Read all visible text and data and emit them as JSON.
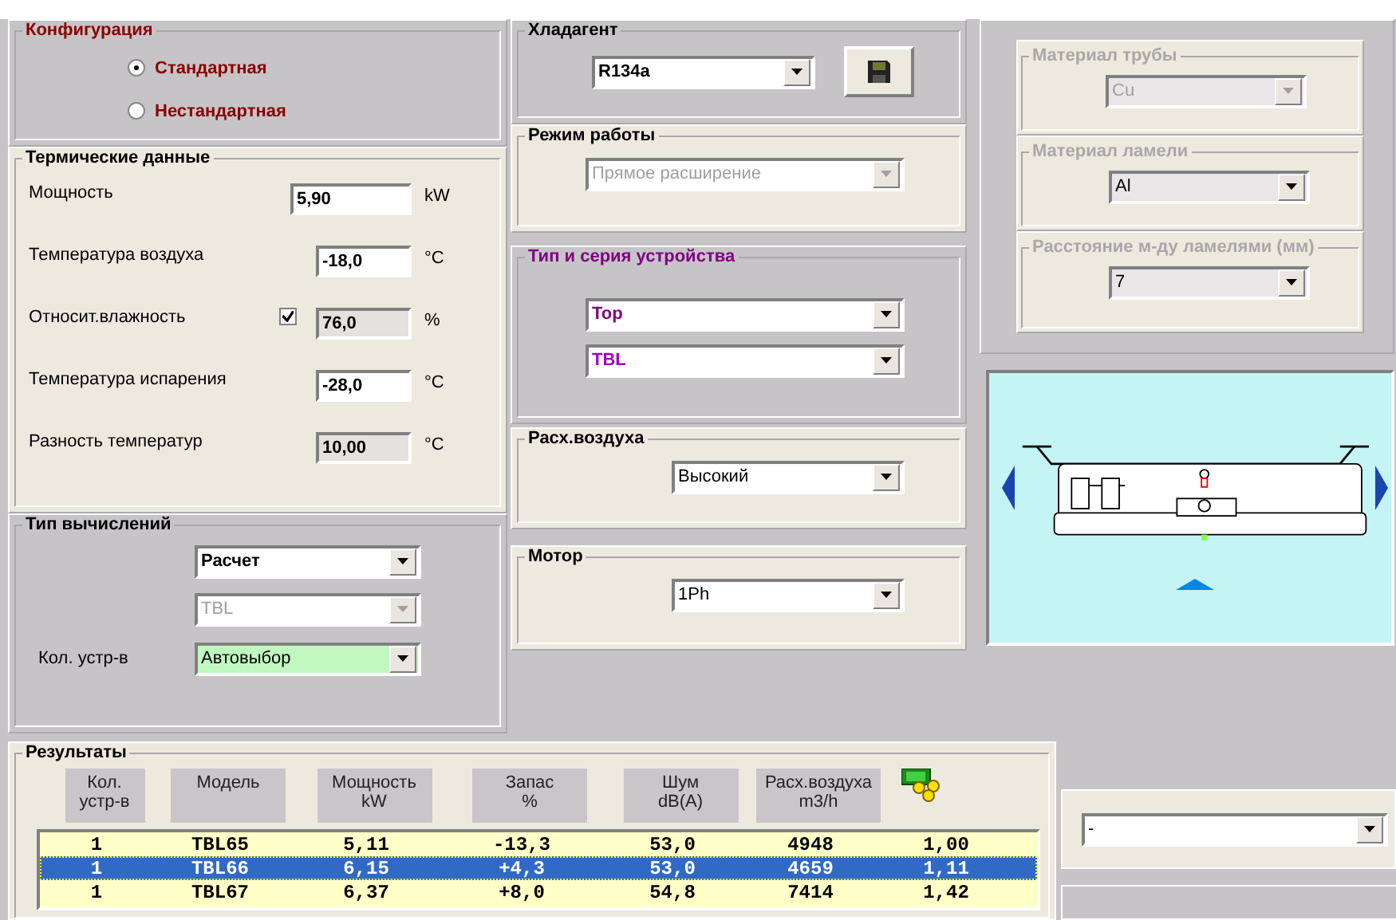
{
  "configuration": {
    "title": "Конфигурация",
    "options": [
      {
        "label": "Стандартная",
        "selected": true
      },
      {
        "label": "Нестандартная",
        "selected": false
      }
    ]
  },
  "thermal": {
    "title": "Термические данные",
    "fields": [
      {
        "kind": "wide",
        "label": "Мощность",
        "value": "5,90",
        "unit": "kW",
        "readonly": false
      },
      {
        "kind": "plain",
        "label": "Температура воздуха",
        "value": "-18,0",
        "unit": "°C",
        "readonly": false
      },
      {
        "kind": "check",
        "label": "Относит.влажность",
        "value": "76,0",
        "unit": "%",
        "readonly": true,
        "checked": true
      },
      {
        "kind": "plain",
        "label": "Температура испарения",
        "value": "-28,0",
        "unit": "°C",
        "readonly": false
      },
      {
        "kind": "plain",
        "label": "Разность температур",
        "value": "10,00",
        "unit": "°C",
        "readonly": true
      }
    ]
  },
  "calculation": {
    "title": "Тип вычислений",
    "mode": {
      "value": "Расчет",
      "disabled": false
    },
    "series": {
      "value": "TBL",
      "disabled": true
    },
    "count": {
      "label": "Кол. устр-в",
      "value": "Автовыбор",
      "disabled": false
    }
  },
  "refrigerant": {
    "title": "Хладагент",
    "value": "R134a",
    "disabled": false
  },
  "operation": {
    "title": "Режим работы",
    "value": "Прямое расширение",
    "disabled": true
  },
  "device": {
    "title": "Тип и серия устройства",
    "type": {
      "value": "Top",
      "disabled": false
    },
    "series": {
      "value": "TBL",
      "disabled": false
    }
  },
  "airflow": {
    "title": "Расх.воздуха",
    "value": "Высокий",
    "disabled": false
  },
  "motor": {
    "title": "Мотор",
    "value": "1Ph",
    "disabled": false
  },
  "materials": [
    {
      "title": "Материал трубы",
      "value": "Cu",
      "disabled": true
    },
    {
      "title": "Материал ламели",
      "value": "Al",
      "disabled": false
    },
    {
      "title": "Расстояние м-ду ламелями (мм)",
      "value": "7",
      "disabled": false
    }
  ],
  "results": {
    "title": "Результаты",
    "columns": [
      {
        "kind": "text",
        "lines": [
          "Кол.",
          "устр-в"
        ]
      },
      {
        "kind": "text",
        "lines": [
          "Модель"
        ]
      },
      {
        "kind": "text",
        "lines": [
          "Мощность",
          "kW"
        ]
      },
      {
        "kind": "text",
        "lines": [
          "Запас",
          "%"
        ]
      },
      {
        "kind": "text",
        "lines": [
          "Шум",
          "dB(A)"
        ]
      },
      {
        "kind": "text",
        "lines": [
          "Расх.воздуха",
          "m3/h"
        ]
      },
      {
        "kind": "price"
      }
    ],
    "rows": [
      {
        "selected": false,
        "cells": [
          "1",
          "TBL65",
          "5,11",
          "-13,3",
          "53,0",
          "4948",
          "1,00"
        ]
      },
      {
        "selected": true,
        "cells": [
          "1",
          "TBL66",
          "6,15",
          "+4,3",
          "53,0",
          "4659",
          "1,11"
        ]
      },
      {
        "selected": false,
        "cells": [
          "1",
          "TBL67",
          "6,37",
          "+8,0",
          "54,8",
          "7414",
          "1,42"
        ]
      }
    ]
  },
  "extra": {
    "value": "-",
    "disabled": false
  }
}
